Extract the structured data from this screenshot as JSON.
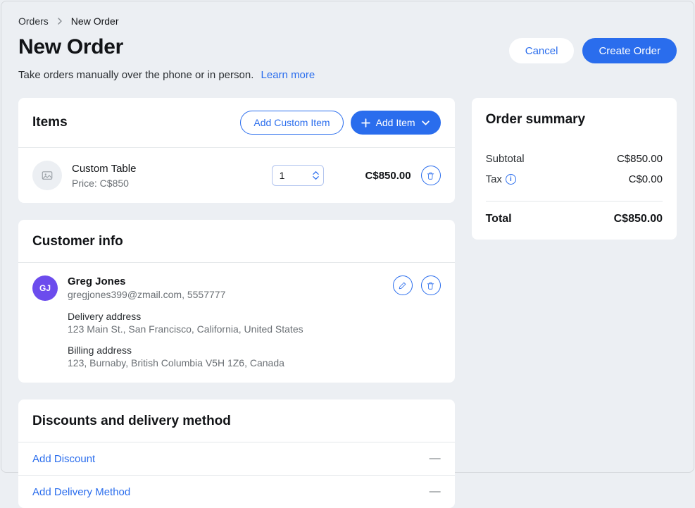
{
  "breadcrumb": {
    "parent": "Orders",
    "current": "New Order"
  },
  "header": {
    "title": "New Order",
    "subtitle": "Take orders manually over the phone or in person.",
    "learn_more": "Learn more",
    "cancel": "Cancel",
    "create": "Create Order"
  },
  "items": {
    "title": "Items",
    "add_custom": "Add Custom Item",
    "add_item": "Add Item",
    "rows": [
      {
        "name": "Custom Table",
        "price_line": "Price: C$850",
        "qty": "1",
        "total": "C$850.00"
      }
    ]
  },
  "customer": {
    "title": "Customer info",
    "initials": "GJ",
    "name": "Greg Jones",
    "contact": "gregjones399@zmail.com, 5557777",
    "delivery_label": "Delivery address",
    "delivery_value": "123 Main St., San Francisco, California, United States",
    "billing_label": "Billing address",
    "billing_value": "123, Burnaby, British Columbia V5H 1Z6, Canada"
  },
  "discounts": {
    "title": "Discounts and delivery method",
    "add_discount": "Add Discount",
    "add_delivery": "Add Delivery Method",
    "dash": "—"
  },
  "summary": {
    "title": "Order summary",
    "subtotal_label": "Subtotal",
    "subtotal_value": "C$850.00",
    "tax_label": "Tax",
    "tax_value": "C$0.00",
    "total_label": "Total",
    "total_value": "C$850.00"
  }
}
